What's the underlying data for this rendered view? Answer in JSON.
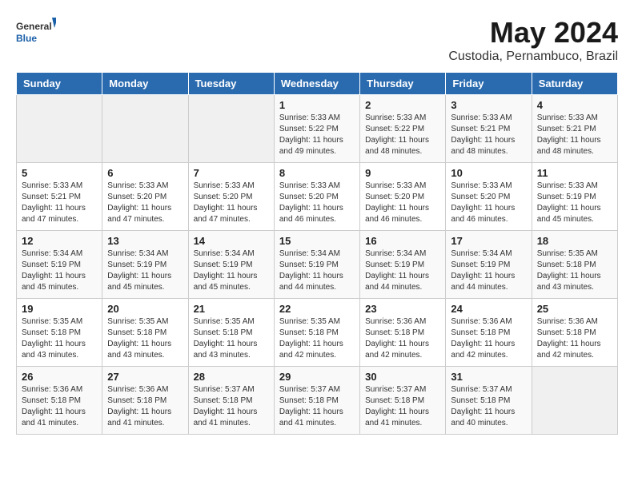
{
  "logo": {
    "general": "General",
    "blue": "Blue"
  },
  "title": "May 2024",
  "subtitle": "Custodia, Pernambuco, Brazil",
  "headers": [
    "Sunday",
    "Monday",
    "Tuesday",
    "Wednesday",
    "Thursday",
    "Friday",
    "Saturday"
  ],
  "weeks": [
    [
      {
        "day": "",
        "info": ""
      },
      {
        "day": "",
        "info": ""
      },
      {
        "day": "",
        "info": ""
      },
      {
        "day": "1",
        "info": "Sunrise: 5:33 AM\nSunset: 5:22 PM\nDaylight: 11 hours\nand 49 minutes."
      },
      {
        "day": "2",
        "info": "Sunrise: 5:33 AM\nSunset: 5:22 PM\nDaylight: 11 hours\nand 48 minutes."
      },
      {
        "day": "3",
        "info": "Sunrise: 5:33 AM\nSunset: 5:21 PM\nDaylight: 11 hours\nand 48 minutes."
      },
      {
        "day": "4",
        "info": "Sunrise: 5:33 AM\nSunset: 5:21 PM\nDaylight: 11 hours\nand 48 minutes."
      }
    ],
    [
      {
        "day": "5",
        "info": "Sunrise: 5:33 AM\nSunset: 5:21 PM\nDaylight: 11 hours\nand 47 minutes."
      },
      {
        "day": "6",
        "info": "Sunrise: 5:33 AM\nSunset: 5:20 PM\nDaylight: 11 hours\nand 47 minutes."
      },
      {
        "day": "7",
        "info": "Sunrise: 5:33 AM\nSunset: 5:20 PM\nDaylight: 11 hours\nand 47 minutes."
      },
      {
        "day": "8",
        "info": "Sunrise: 5:33 AM\nSunset: 5:20 PM\nDaylight: 11 hours\nand 46 minutes."
      },
      {
        "day": "9",
        "info": "Sunrise: 5:33 AM\nSunset: 5:20 PM\nDaylight: 11 hours\nand 46 minutes."
      },
      {
        "day": "10",
        "info": "Sunrise: 5:33 AM\nSunset: 5:20 PM\nDaylight: 11 hours\nand 46 minutes."
      },
      {
        "day": "11",
        "info": "Sunrise: 5:33 AM\nSunset: 5:19 PM\nDaylight: 11 hours\nand 45 minutes."
      }
    ],
    [
      {
        "day": "12",
        "info": "Sunrise: 5:34 AM\nSunset: 5:19 PM\nDaylight: 11 hours\nand 45 minutes."
      },
      {
        "day": "13",
        "info": "Sunrise: 5:34 AM\nSunset: 5:19 PM\nDaylight: 11 hours\nand 45 minutes."
      },
      {
        "day": "14",
        "info": "Sunrise: 5:34 AM\nSunset: 5:19 PM\nDaylight: 11 hours\nand 45 minutes."
      },
      {
        "day": "15",
        "info": "Sunrise: 5:34 AM\nSunset: 5:19 PM\nDaylight: 11 hours\nand 44 minutes."
      },
      {
        "day": "16",
        "info": "Sunrise: 5:34 AM\nSunset: 5:19 PM\nDaylight: 11 hours\nand 44 minutes."
      },
      {
        "day": "17",
        "info": "Sunrise: 5:34 AM\nSunset: 5:19 PM\nDaylight: 11 hours\nand 44 minutes."
      },
      {
        "day": "18",
        "info": "Sunrise: 5:35 AM\nSunset: 5:18 PM\nDaylight: 11 hours\nand 43 minutes."
      }
    ],
    [
      {
        "day": "19",
        "info": "Sunrise: 5:35 AM\nSunset: 5:18 PM\nDaylight: 11 hours\nand 43 minutes."
      },
      {
        "day": "20",
        "info": "Sunrise: 5:35 AM\nSunset: 5:18 PM\nDaylight: 11 hours\nand 43 minutes."
      },
      {
        "day": "21",
        "info": "Sunrise: 5:35 AM\nSunset: 5:18 PM\nDaylight: 11 hours\nand 43 minutes."
      },
      {
        "day": "22",
        "info": "Sunrise: 5:35 AM\nSunset: 5:18 PM\nDaylight: 11 hours\nand 42 minutes."
      },
      {
        "day": "23",
        "info": "Sunrise: 5:36 AM\nSunset: 5:18 PM\nDaylight: 11 hours\nand 42 minutes."
      },
      {
        "day": "24",
        "info": "Sunrise: 5:36 AM\nSunset: 5:18 PM\nDaylight: 11 hours\nand 42 minutes."
      },
      {
        "day": "25",
        "info": "Sunrise: 5:36 AM\nSunset: 5:18 PM\nDaylight: 11 hours\nand 42 minutes."
      }
    ],
    [
      {
        "day": "26",
        "info": "Sunrise: 5:36 AM\nSunset: 5:18 PM\nDaylight: 11 hours\nand 41 minutes."
      },
      {
        "day": "27",
        "info": "Sunrise: 5:36 AM\nSunset: 5:18 PM\nDaylight: 11 hours\nand 41 minutes."
      },
      {
        "day": "28",
        "info": "Sunrise: 5:37 AM\nSunset: 5:18 PM\nDaylight: 11 hours\nand 41 minutes."
      },
      {
        "day": "29",
        "info": "Sunrise: 5:37 AM\nSunset: 5:18 PM\nDaylight: 11 hours\nand 41 minutes."
      },
      {
        "day": "30",
        "info": "Sunrise: 5:37 AM\nSunset: 5:18 PM\nDaylight: 11 hours\nand 41 minutes."
      },
      {
        "day": "31",
        "info": "Sunrise: 5:37 AM\nSunset: 5:18 PM\nDaylight: 11 hours\nand 40 minutes."
      },
      {
        "day": "",
        "info": ""
      }
    ]
  ]
}
